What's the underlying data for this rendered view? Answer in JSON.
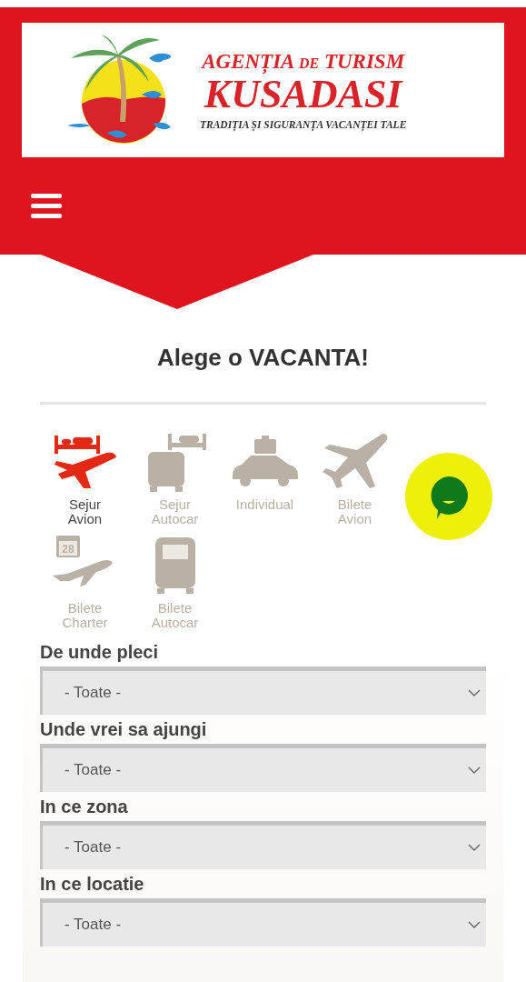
{
  "header": {
    "logo": {
      "line_1": "AGENȚIA de TURISM",
      "line_2": "KUSADASI",
      "tagline": "TRADIȚIA ȘI SIGURANȚA VACANȚEI TALE"
    }
  },
  "title": "Alege o VACANTA!",
  "categories": [
    {
      "kind": "bed-plane",
      "label": "Sejur Avion",
      "selected": true
    },
    {
      "kind": "bus-bed",
      "label": "Sejur Autocar",
      "selected": false
    },
    {
      "kind": "car-luggage",
      "label": "Individual",
      "selected": false
    },
    {
      "kind": "plane",
      "label": "Bilete Avion",
      "selected": false
    },
    {
      "kind": "calendar-plane",
      "label": "Bilete Charter",
      "selected": false,
      "calendar_day": "28"
    },
    {
      "kind": "bus",
      "label": "Bilete Autocar",
      "selected": false
    }
  ],
  "fields": [
    {
      "label": "De unde pleci",
      "value": "- Toate -"
    },
    {
      "label": "Unde vrei sa ajungi",
      "value": "- Toate -"
    },
    {
      "label": "In ce zona",
      "value": "- Toate -"
    },
    {
      "label": "In ce locatie",
      "value": "- Toate -"
    }
  ]
}
